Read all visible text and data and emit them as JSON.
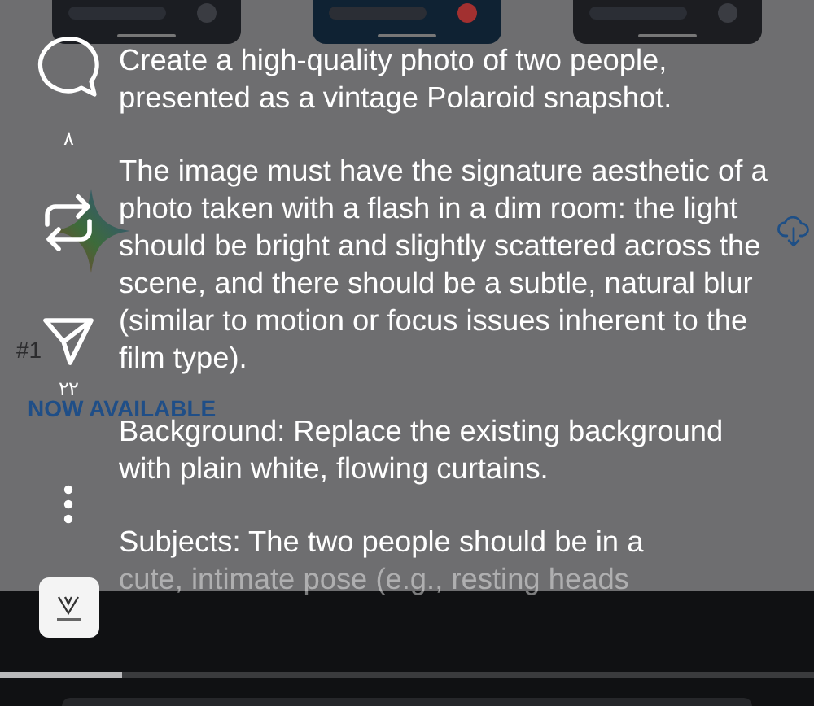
{
  "app_listing": {
    "rank": "#1",
    "banner": "NOW AVAILABLE"
  },
  "actions": [
    {
      "kind": "comment",
      "count": "٨"
    },
    {
      "kind": "repost"
    },
    {
      "kind": "send",
      "count": "٢٢"
    },
    {
      "kind": "more"
    },
    {
      "kind": "avatar"
    }
  ],
  "caption": [
    {
      "text": "Create a high-quality photo of two people, presented as a vintage Polaroid snapshot."
    },
    {
      "text": "The image must have the signature aesthetic of a photo taken with a flash in a dim room: the light should be bright and slightly scattered across the scene, and there should be a subtle, natural blur (similar to motion or focus issues inherent to the film type)."
    },
    {
      "text": "Background: Replace the existing background with plain white, flowing curtains."
    },
    {
      "text": "Subjects: The two people should be in a"
    },
    {
      "text": "cute, intimate pose (e.g., resting heads",
      "faded": true
    }
  ],
  "progress": {
    "level": 0.15
  }
}
